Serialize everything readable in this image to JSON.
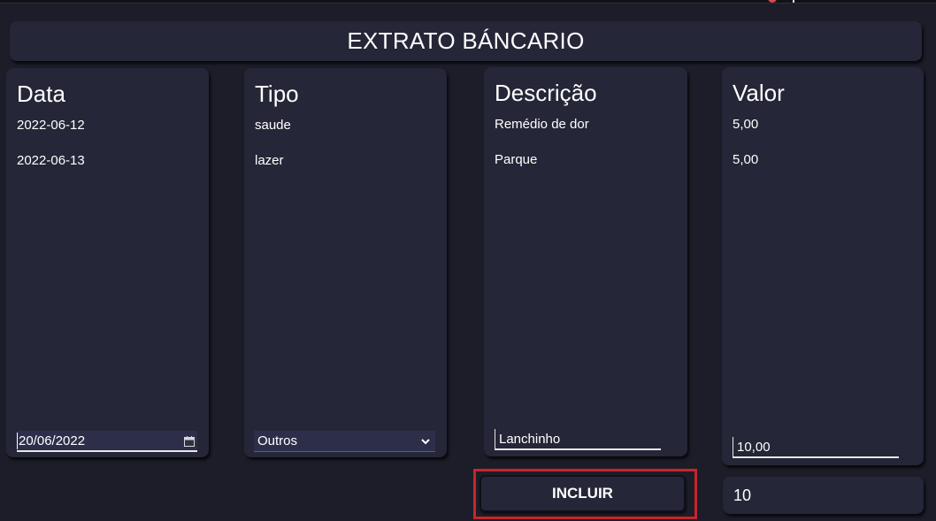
{
  "header": {
    "title": "EXTRATO BÁNCARIO"
  },
  "columns": {
    "data": {
      "heading": "Data",
      "items": [
        "2022-06-12",
        "2022-06-13"
      ],
      "input_value": "20/06/2022"
    },
    "tipo": {
      "heading": "Tipo",
      "items": [
        "saude",
        "lazer"
      ],
      "select_value": "Outros"
    },
    "descricao": {
      "heading": "Descrição",
      "items": [
        "Remédio de dor",
        "Parque"
      ],
      "input_value": "Lanchinho"
    },
    "valor": {
      "heading": "Valor",
      "items": [
        "5,00",
        "5,00"
      ],
      "input_value": "10,00"
    }
  },
  "actions": {
    "incluir_label": "INCLUIR"
  },
  "total": {
    "value": "10"
  },
  "colors": {
    "background": "#1c1d29",
    "card": "#252637",
    "input_bg": "#2d2f4a",
    "highlight": "#c8252b"
  },
  "icons": {
    "date_picker": "calendar-icon",
    "select": "chevron-down-icon"
  }
}
